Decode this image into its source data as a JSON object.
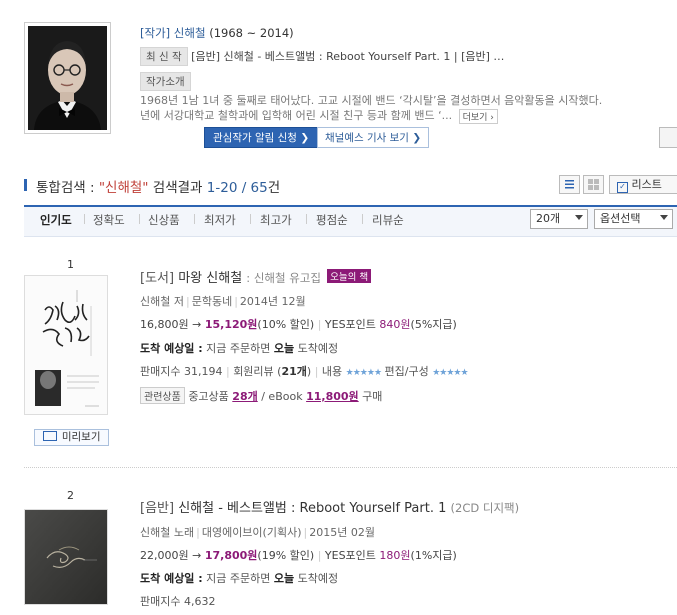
{
  "author": {
    "kind": "[작가]",
    "name": "신해철",
    "years": "(1968 ~ 2014)",
    "latest_tag": "최 신 작",
    "latest_text": "[음반] 신해철 - 베스트앨범 : Reboot Yourself Part. 1 | [음반] …",
    "intro_tag": "작가소개",
    "intro_line1": "1968년 1남 1녀 중 둘째로 태어났다. 고교 시절에 밴드 ‘각시탈’을 결성하면서 음악활동을 시작했다.",
    "intro_line2": "년에 서강대학교 철학과에 입학해 어린 시절 친구 등과 함께 밴드 ‘...",
    "more_label": "더보기",
    "follow_button": "관심작가 알림 신청",
    "news_button": "채널예스 기사 보기"
  },
  "search": {
    "prefix": "통합검색 : ",
    "keyword": "\"신해철\"",
    "middle": " 검색결과 ",
    "range": "1-20",
    "slash": " / ",
    "total": "65",
    "unit": "건",
    "list_button": "리스트"
  },
  "sort": {
    "tabs": [
      "인기도",
      "정확도",
      "신상품",
      "최저가",
      "최고가",
      "평점순",
      "리뷰순"
    ],
    "per_page": "20개",
    "option": "옵션선택"
  },
  "items": [
    {
      "rank": "1",
      "kind": "[도서]",
      "title": "마왕 신해철",
      "subtitle": ": 신해철 유고집",
      "badge": "오늘의 책",
      "author": "신해철 저",
      "publisher": "문학동네",
      "date": "2014년 12월",
      "list_price": "16,800원",
      "arrow": "→",
      "sale_price": "15,120원",
      "discount": "(10% 할인)",
      "points_label": "YES포인트",
      "points": "840원",
      "points_rate": "(5%지급)",
      "delivery_label": "도착 예상일 :",
      "delivery_text": "지금 주문하면",
      "delivery_day": "오늘",
      "delivery_tail": "도착예정",
      "sales_index": "판매지수 31,194",
      "review_label": "회원리뷰 (",
      "review_count": "21개",
      "review_close": ")",
      "content_label": "내용",
      "content_stars": "★★★★★",
      "edit_label": "편집/구성",
      "edit_stars": "★★★★★",
      "related_label": "관련상품",
      "used_label": "중고상품",
      "used_count": "28개",
      "ebook_label": "/ eBook",
      "ebook_price": "11,800원",
      "buy_label": "구매",
      "preview_label": "미리보기"
    },
    {
      "rank": "2",
      "kind": "[음반]",
      "title": "신해철 - 베스트앨범 : Reboot Yourself Part. 1",
      "subtitle": "(2CD 디지팩)",
      "author": "신해철 노래",
      "publisher": "대영에이브이(기획사)",
      "date": "2015년 02월",
      "list_price": "22,000원",
      "arrow": "→",
      "sale_price": "17,800원",
      "discount": "(19% 할인)",
      "points_label": "YES포인트",
      "points": "180원",
      "points_rate": "(1%지급)",
      "delivery_label": "도착 예상일 :",
      "delivery_text": "지금 주문하면",
      "delivery_day": "오늘",
      "delivery_tail": "도착예정",
      "sales_index": "판매지수 4,632"
    }
  ],
  "icons": {
    "list_view": "list-view-icon",
    "grid_view": "grid-view-icon",
    "checkbox": "checkbox-icon",
    "preview": "book-icon",
    "chevron": "chevron-right-icon"
  }
}
